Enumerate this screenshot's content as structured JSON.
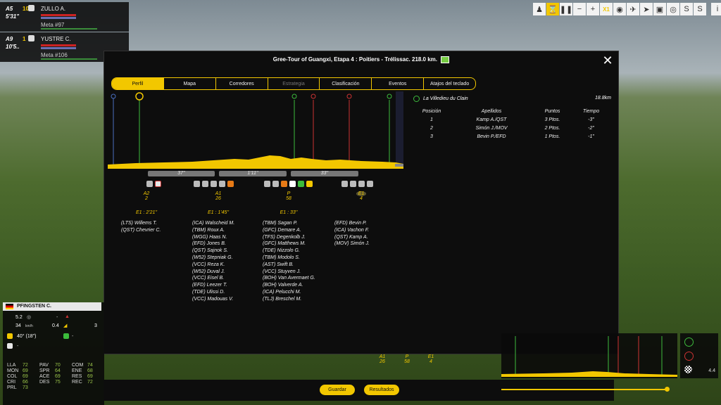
{
  "top_riders": [
    {
      "position": "A5",
      "gap": "5'31\"",
      "number": "10",
      "name": "ZULLO A.",
      "meta": "Meta #97"
    },
    {
      "position": "A9",
      "gap": "10'5..",
      "number": "1",
      "name": "YUSTRE C.",
      "meta": "Meta #106"
    }
  ],
  "toolbar": {
    "speed_label": "X1"
  },
  "modal": {
    "title": "Gree-Tour of Guangxi, Etapa 4 : Poitiers - Trélissac. 218.0 km.",
    "tabs": [
      "Perfil",
      "Mapa",
      "Corredores",
      "Estrategia",
      "Clasificación",
      "Eventos",
      "Atajos del teclado"
    ],
    "active_tab": "Perfil"
  },
  "profile": {
    "gaps": [
      "37''",
      "1'11''",
      "33''"
    ],
    "groups": [
      {
        "label": "A2",
        "count": "2",
        "time": "E1 : 2'21''",
        "riders": [
          "(LTS) Willems T.",
          "(QST) Chevrier C."
        ]
      },
      {
        "label": "A1",
        "count": "26",
        "time": "E1 : 1'45''",
        "riders": [
          "(ICA) Walscheid M.",
          "(TBM) Roux A.",
          "(WGG) Haas N.",
          "(EFD) Jones B.",
          "(QST) Sajnok S.",
          "(W52) Stepniak G.",
          "(VCC) Reza K.",
          "(W52) Duval J.",
          "(VCC) Eisel B.",
          "(EFD) Leezer T.",
          "(TDE) Ulissi D.",
          "(VCC) Madouas V."
        ]
      },
      {
        "label": "P",
        "count": "58",
        "time": "E1 : 33''",
        "riders": [
          "(TBM) Sagan P.",
          "(GFC) Demare A.",
          "(TFS) Degenkolb J.",
          "(GFC) Matthews M.",
          "(TDE) Nizzolo G.",
          "(TBM) Modolo S.",
          "(AST) Swift B.",
          "(VCC) Stuyven J.",
          "(BOH) Van Avermaet G.",
          "(BOH) Valverde A.",
          "(ICA) Pelucchi M.",
          "(TLJ) Breschel M."
        ]
      },
      {
        "label": "E1",
        "count": "4",
        "time": "",
        "riders": [
          "(EFD) Bevin P.",
          "(ICA) Vachon F.",
          "(QST) Kamp A.",
          "(MOV) Simón J."
        ]
      }
    ]
  },
  "sprint": {
    "name": "La Villedieu du Clain",
    "distance": "18.8km",
    "headers": [
      "Posición",
      "Apellidos",
      "Puntos",
      "Tiempo"
    ],
    "rows": [
      {
        "pos": "1",
        "name": "Kamp A./QST",
        "points": "3 Ptos.",
        "time": "-3\""
      },
      {
        "pos": "2",
        "name": "Simón J./MOV",
        "points": "2 Ptos.",
        "time": "-2\""
      },
      {
        "pos": "3",
        "name": "Bevin P./EFD",
        "points": "1 Ptos.",
        "time": "-1\""
      }
    ]
  },
  "rider_detail": {
    "name": "PFINGSTEN C.",
    "speed1": "5.2",
    "speed2": "34",
    "speed_unit": "km/h",
    "slope": "0.4",
    "value3": "3",
    "temp": "40° (18\")",
    "dash1": "-",
    "dash2": "-",
    "dash3": "-",
    "attributes": [
      {
        "k": "LLA",
        "v": "72"
      },
      {
        "k": "PAV",
        "v": "70"
      },
      {
        "k": "COM",
        "v": "74"
      },
      {
        "k": "MON",
        "v": "69"
      },
      {
        "k": "SPR",
        "v": "64"
      },
      {
        "k": "ENE",
        "v": "68"
      },
      {
        "k": "COL",
        "v": "69"
      },
      {
        "k": "ACE",
        "v": "69"
      },
      {
        "k": "RES",
        "v": "69"
      },
      {
        "k": "CRI",
        "v": "66"
      },
      {
        "k": "DES",
        "v": "75"
      },
      {
        "k": "REC",
        "v": "72"
      },
      {
        "k": "PRL",
        "v": "73"
      }
    ]
  },
  "bottom": {
    "guardar": "Guardar",
    "resultados": "Resultados",
    "groups": [
      {
        "label": "A1",
        "count": "26"
      },
      {
        "label": "P",
        "count": "58"
      },
      {
        "label": "E1",
        "count": "4"
      }
    ],
    "remaining": "4.4"
  }
}
